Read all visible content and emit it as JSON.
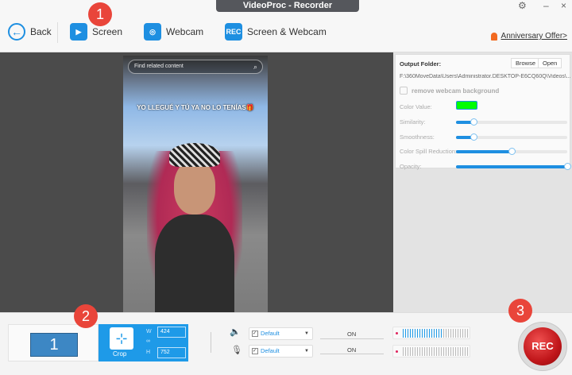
{
  "window": {
    "title": "VideoProc - Recorder",
    "settings_icon": "gear-icon",
    "minimize": "–",
    "close": "×"
  },
  "toolbar": {
    "back": "Back",
    "screen": "Screen",
    "webcam": "Webcam",
    "screen_webcam": "Screen & Webcam",
    "rec_icon_text": "REC",
    "offer": "Anniversary Offer>"
  },
  "badges": [
    "1",
    "2",
    "3"
  ],
  "video": {
    "search_placeholder": "Find related content",
    "caption": "YO LLEGUÉ Y TÚ YA NO LO TENÍAS🎁"
  },
  "panel": {
    "output_label": "Output Folder:",
    "browse": "Browse",
    "open": "Open",
    "path": "F:\\360MoveData\\Users\\Administrator.DESKTOP-E6CQ60Q\\Videos\\...",
    "remove_bg": "remove webcam background",
    "color_value": "Color Value:",
    "color": "#00ff00",
    "sliders": [
      {
        "label": "Similarity:",
        "value": 0.16
      },
      {
        "label": "Smoothness:",
        "value": 0.16
      },
      {
        "label": "Color Spill Reduction:",
        "value": 0.5
      },
      {
        "label": "Opacity:",
        "value": 1.0
      }
    ]
  },
  "bottom": {
    "monitor": "1",
    "crop": "Crop",
    "w_label": "W",
    "h_label": "H",
    "width": "424",
    "height": "752",
    "speaker": {
      "device": "Default",
      "status": "ON",
      "level": 0.6
    },
    "mic": {
      "device": "Default",
      "status": "ON",
      "level": 0
    },
    "rec": "REC"
  }
}
